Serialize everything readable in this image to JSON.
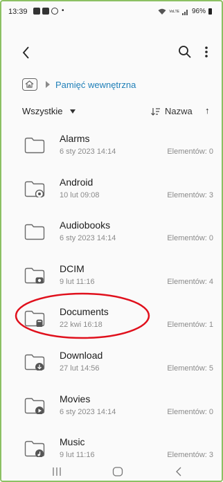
{
  "status_bar": {
    "time": "13:39",
    "dot": "•",
    "network": "VoLTE",
    "battery": "96%"
  },
  "app_bar": {
    "back_icon": "back-arrow-icon",
    "search_icon": "search-icon",
    "more_icon": "more-vert-icon"
  },
  "breadcrumb": {
    "home_icon": "home-icon",
    "label": "Pamięć wewnętrzna"
  },
  "sort_bar": {
    "filter_label": "Wszystkie",
    "sort_label": "Nazwa",
    "sort_direction": "↑"
  },
  "files": [
    {
      "name": "Alarms",
      "date": "6 sty 2023 14:14",
      "count": "Elementów: 0",
      "badge": "none"
    },
    {
      "name": "Android",
      "date": "10 lut 09:08",
      "count": "Elementów: 3",
      "badge": "gear"
    },
    {
      "name": "Audiobooks",
      "date": "6 sty 2023 14:14",
      "count": "Elementów: 0",
      "badge": "none"
    },
    {
      "name": "DCIM",
      "date": "9 lut 11:16",
      "count": "Elementów: 4",
      "badge": "camera"
    },
    {
      "name": "Documents",
      "date": "22 kwi 16:18",
      "count": "Elementów: 1",
      "badge": "document"
    },
    {
      "name": "Download",
      "date": "27 lut 14:56",
      "count": "Elementów: 5",
      "badge": "download"
    },
    {
      "name": "Movies",
      "date": "6 sty 2023 14:14",
      "count": "Elementów: 0",
      "badge": "play"
    },
    {
      "name": "Music",
      "date": "9 lut 11:16",
      "count": "Elementów: 3",
      "badge": "music"
    }
  ],
  "highlight": {
    "target": "Documents",
    "color": "#e0101c"
  },
  "nav_bar": {
    "recent_icon": "recent-apps-icon",
    "home_icon": "nav-home-icon",
    "back_icon": "nav-back-icon"
  },
  "colors": {
    "accent": "#1f7fb8",
    "frame": "#8cc063",
    "text": "#1b1b1b",
    "secondary": "#8a8a8a"
  }
}
